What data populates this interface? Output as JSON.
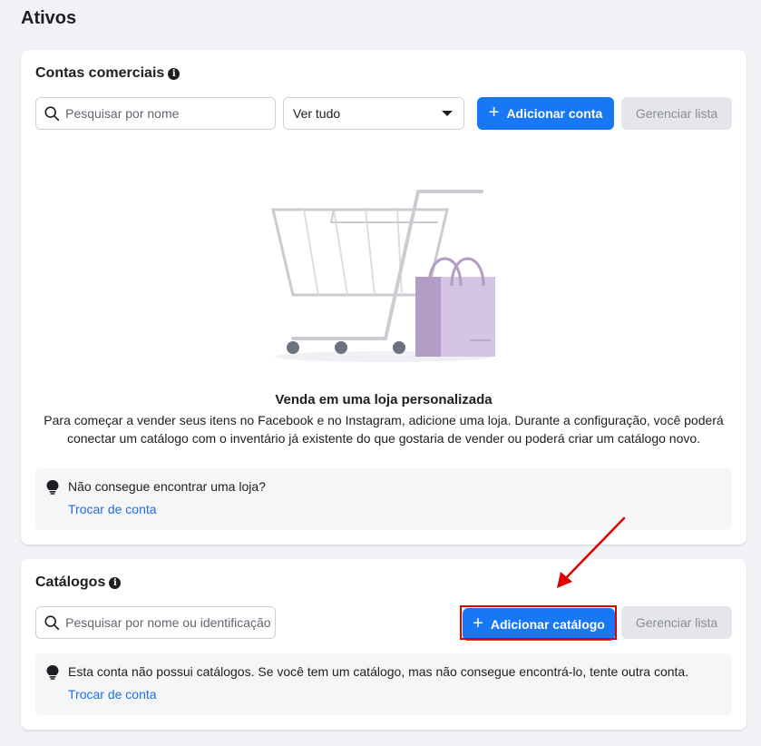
{
  "page_title": "Ativos",
  "accounts_section": {
    "title": "Contas comerciais",
    "search_placeholder": "Pesquisar por nome",
    "filter_value": "Ver tudo",
    "add_button": "Adicionar conta",
    "manage_button": "Gerenciar lista",
    "empty_title": "Venda em uma loja personalizada",
    "empty_description": "Para começar a vender seus itens no Facebook e no Instagram, adicione uma loja. Durante a configuração, você poderá conectar um catálogo com o inventário já existente do que gostaria de vender ou poderá criar um catálogo novo.",
    "tip_text": "Não consegue encontrar uma loja?",
    "tip_link": "Trocar de conta"
  },
  "catalogs_section": {
    "title": "Catálogos",
    "search_placeholder": "Pesquisar por nome ou identificação",
    "add_button": "Adicionar catálogo",
    "manage_button": "Gerenciar lista",
    "tip_text": "Esta conta não possui catálogos. Se você tem um catálogo, mas não consegue encontrá-lo, tente outra conta.",
    "tip_link": "Trocar de conta"
  },
  "colors": {
    "primary": "#1877f2",
    "annotation": "#e00000",
    "link": "#216fdb"
  },
  "icons": [
    "info-icon",
    "search-icon",
    "chevron-down-icon",
    "plus-icon",
    "lightbulb-icon",
    "shopping-cart-illustration",
    "annotation-arrow"
  ]
}
